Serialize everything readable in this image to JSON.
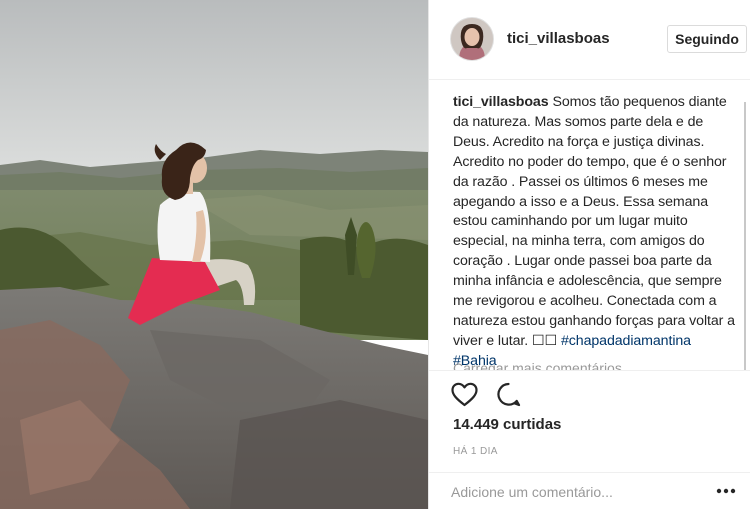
{
  "post": {
    "username": "tici_villasboas",
    "follow_label": "Seguindo",
    "caption": {
      "user": "tici_villasboas",
      "text": "Somos tão pequenos diante da natureza. Mas somos parte dela e de Deus. Acredito na força e justiça divinas. Acredito no poder do tempo, que é o senhor da razão . Passei os últimos 6 meses me apegando a isso e a Deus. Essa semana estou caminhando por um lugar muito especial, na minha terra, com amigos do coração . Lugar onde passei boa parte da minha infância e adolescência, que sempre me revigorou e acolheu. Conectada com a natureza estou ganhando forças para voltar a viver e lutar. ☐☐",
      "hashtags": [
        "#chapadadiamantina",
        "#Bahia"
      ]
    },
    "load_more": "Carregar mais comentários",
    "likes": "14.449 curtidas",
    "time": "HÁ 1 DIA",
    "comment_placeholder": "Adicione um comentário...",
    "icons": {
      "like": "heart-icon",
      "comment": "comment-icon",
      "more": "more-options-icon"
    }
  }
}
